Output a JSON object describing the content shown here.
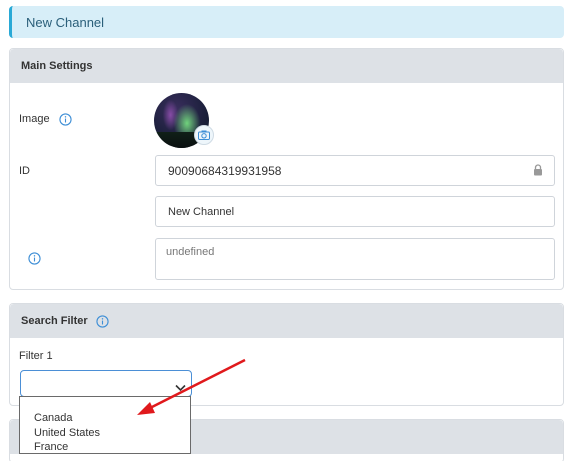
{
  "header": {
    "title": "New Channel"
  },
  "main_settings": {
    "title": "Main Settings",
    "image_label": "Image",
    "id_label": "ID",
    "id_value": "90090684319931958",
    "name_value": "New Channel",
    "description_value": "undefined"
  },
  "search_filter": {
    "title": "Search Filter",
    "filter_label": "Filter 1",
    "selected": "",
    "options": [
      "Canada",
      "United States",
      "France"
    ]
  },
  "colors": {
    "accent": "#29a9d6",
    "header_bg": "#d7eef8",
    "annotation_arrow": "#e0191c"
  },
  "icons": [
    "info-icon",
    "camera-icon",
    "lock-icon",
    "chevron-down-icon"
  ]
}
